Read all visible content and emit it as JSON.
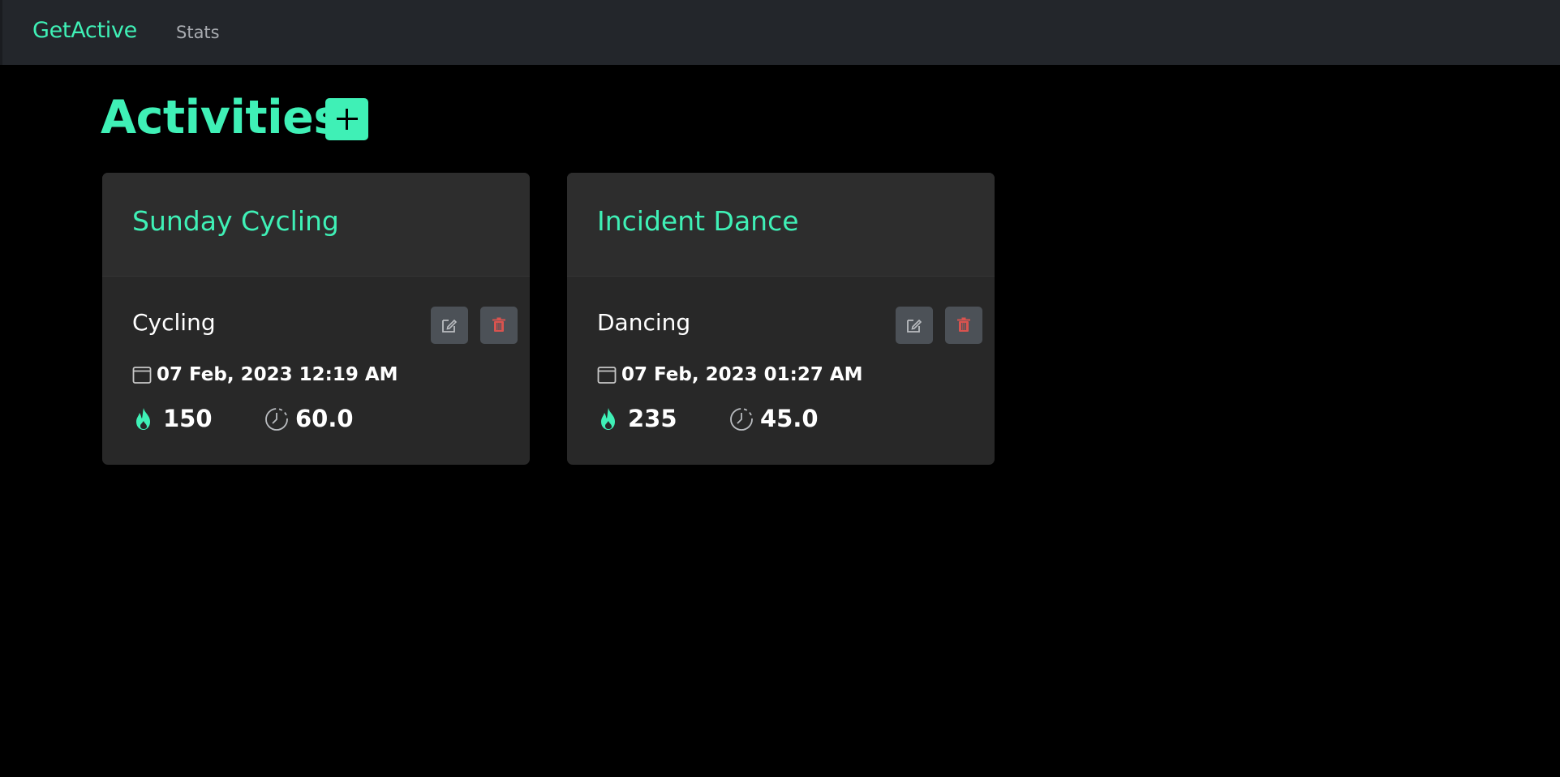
{
  "navbar": {
    "brand": "GetActive",
    "links": [
      {
        "label": "Stats"
      }
    ]
  },
  "page": {
    "title": "Activities",
    "add_icon": "plus-icon"
  },
  "colors": {
    "accent": "#3ff0b6",
    "navbar_bg": "#23262b",
    "card_bg": "#282828",
    "button_bg": "#4c5157",
    "delete_red": "#d9534f"
  },
  "activities": [
    {
      "name": "Sunday Cycling",
      "type": "Cycling",
      "date": "07 Feb, 2023 12:19 AM",
      "calories": "150",
      "duration": "60.0",
      "icons": {
        "edit": "edit-icon",
        "delete": "trash-icon",
        "date": "calendar-icon",
        "calories": "flame-icon",
        "duration": "clock-icon"
      }
    },
    {
      "name": "Incident Dance",
      "type": "Dancing",
      "date": "07 Feb, 2023 01:27 AM",
      "calories": "235",
      "duration": "45.0",
      "icons": {
        "edit": "edit-icon",
        "delete": "trash-icon",
        "date": "calendar-icon",
        "calories": "flame-icon",
        "duration": "clock-icon"
      }
    }
  ]
}
